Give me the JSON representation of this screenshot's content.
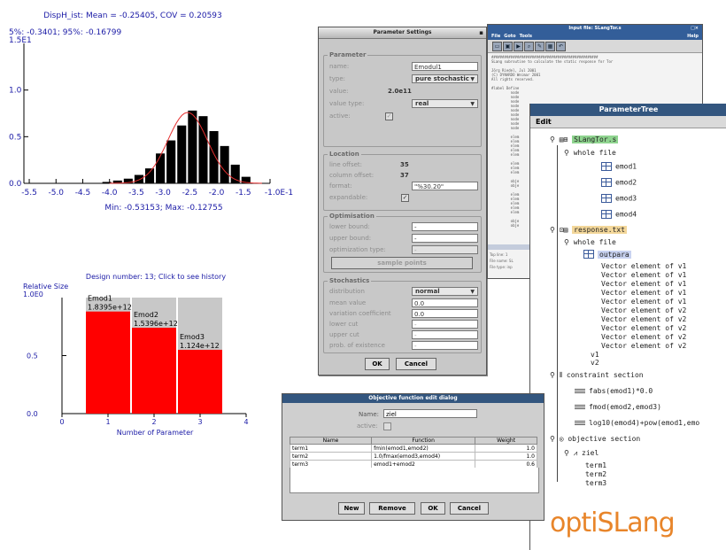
{
  "histogram": {
    "title": "DispH_ist: Mean = -0.25405, COV = 0.20593",
    "percentiles": "5%: -0.3401; 95%: -0.16799",
    "y_multiplier": "1.5E1",
    "y_ticks": [
      "1.0",
      "0.5",
      "0.0"
    ],
    "x_ticks": [
      "-5.5",
      "-5.0",
      "-4.5",
      "-4.0",
      "-3.5",
      "-3.0",
      "-2.5",
      "-2.0",
      "-1.5",
      "-1.0E-1"
    ],
    "range_text": "Min: -0.53153; Max: -0.12755"
  },
  "bar_chart": {
    "title": "Design number: 13; Click to see history",
    "ylabel": "Relative Size",
    "y_top": "1.0E0",
    "y_ticks": [
      "0.5",
      "0.0"
    ],
    "x_ticks": [
      "0",
      "1",
      "2",
      "3",
      "4"
    ],
    "xlabel": "Number of Parameter",
    "bars": [
      {
        "label": "Emod1",
        "value_text": "1.8395e+12"
      },
      {
        "label": "Emod2",
        "value_text": "1.5396e+12"
      },
      {
        "label": "Emod3",
        "value_text": "1.124e+12"
      }
    ]
  },
  "chart_data": [
    {
      "type": "bar",
      "title": "DispH_ist: Mean = -0.25405, COV = 0.20593",
      "x": [
        -4.05,
        -3.85,
        -3.65,
        -3.45,
        -3.25,
        -3.05,
        -2.85,
        -2.65,
        -2.45,
        -2.25,
        -2.05,
        -1.85,
        -1.65,
        -1.45
      ],
      "values": [
        0.015,
        0.03,
        0.05,
        0.09,
        0.16,
        0.32,
        0.46,
        0.62,
        0.78,
        0.72,
        0.56,
        0.4,
        0.2,
        0.07
      ],
      "xlim": [
        -5.6,
        -1.0
      ],
      "ylim": [
        0,
        1.5
      ],
      "fit_curve": true,
      "fit_color": "#e53030"
    },
    {
      "type": "bar",
      "title": "Design number: 13; Click to see history",
      "categories": [
        "Emod1",
        "Emod2",
        "Emod3"
      ],
      "x": [
        1,
        2,
        3
      ],
      "values": [
        0.88,
        0.74,
        0.55
      ],
      "xlim": [
        0,
        4
      ],
      "ylim": [
        0,
        1.0
      ],
      "xlabel": "Number of Parameter",
      "ylabel": "Relative Size",
      "bar_color": "#ff0000",
      "background_color": "#c8c8c8"
    }
  ],
  "param_settings": {
    "title": "Parameter Settings",
    "parameter_group": "Parameter",
    "name_label": "name:",
    "name_value": "Emodul1",
    "type_label": "type:",
    "type_value": "pure stochastic",
    "value_label": "value:",
    "value_value": "2.0e11",
    "value_type_label": "value type:",
    "value_type_value": "real",
    "active_label": "active:",
    "location_group": "Location",
    "line_offset_label": "line offset:",
    "line_offset_value": "35",
    "column_offset_label": "column offset:",
    "column_offset_value": "37",
    "format_label": "format:",
    "format_value": "\"%30.20\"",
    "expandable_label": "expandable:",
    "optimisation_group": "Optimisation",
    "lower_bound_label": "lower bound:",
    "upper_bound_label": "upper bound:",
    "opt_type_label": "optimization type:",
    "sample_points": "sample points",
    "stochastics_group": "Stochastics",
    "distribution_label": "distribution",
    "distribution_value": "normal",
    "mean_label": "mean value",
    "mean_value": "0.0",
    "cov_label": "variation coefficient",
    "cov_value": "0.0",
    "lower_cut_label": "lower cut",
    "upper_cut_label": "upper cut",
    "prob_label": "prob. of existence",
    "ok": "OK",
    "cancel": "Cancel"
  },
  "input_file": {
    "title": "Input file: SLangTor.s",
    "menu": [
      "File",
      "Goto",
      "Tools"
    ],
    "help": "Help",
    "lines": [
      "##################################################",
      "SLang subroutine to calculate the static response for Tor",
      "",
      "Jörg Riedel, Jul 2001",
      "(C) DYNARDO Weimar 2001",
      "All rights reserved.",
      "",
      "#label Define",
      "         node",
      "         node",
      "         node",
      "         node",
      "         node",
      "         node",
      "         node",
      "         node",
      "         node",
      "",
      "         elem",
      "         elem",
      "         elem",
      "         elem",
      "         elem",
      "",
      "         elem",
      "         elem",
      "         elem",
      "",
      "         obje",
      "         obje",
      "",
      "         elem",
      "         elem",
      "         elem",
      "         elem",
      "         elem",
      "",
      "         obje",
      "         obje"
    ],
    "status": [
      "Top line: 1",
      "File name: SL",
      "File type: inp"
    ]
  },
  "param_tree": {
    "title": "ParameterTree",
    "menu": "Edit",
    "file1": "SLangTor.s",
    "whole_file_1": "whole file",
    "emods": [
      "emod1",
      "emod2",
      "emod3",
      "emod4"
    ],
    "file2": "response.txt",
    "whole_file_2": "whole file",
    "outpara": "outpara",
    "vectors": [
      "Vector element of v1",
      "Vector element of v1",
      "Vector element of v1",
      "Vector element of v1",
      "Vector element of v1",
      "Vector element of v2",
      "Vector element of v2",
      "Vector element of v2",
      "Vector element of v2",
      "Vector element of v2"
    ],
    "v1": "v1",
    "v2": "v2",
    "constraint_section": "constraint section",
    "constraints": [
      "fabs(emod1)*0.0",
      "fmod(emod2,emod3)",
      "log10(emod4)+pow(emod1,emo"
    ],
    "objective_section": "objective section",
    "ziel": "ziel",
    "terms": [
      "term1",
      "term2",
      "term3"
    ]
  },
  "objective_dialog": {
    "title": "Objective function edit dialog",
    "name_label": "Name:",
    "name_value": "ziel",
    "active_label": "active:",
    "columns": [
      "Name",
      "Function",
      "Weight"
    ],
    "rows": [
      [
        "term1",
        "fmin(emod1,emod2)",
        "1.0"
      ],
      [
        "term2",
        "1.0/fmax(emod3,emod4)",
        "1.0"
      ],
      [
        "term3",
        "emod1+emod2",
        "0.6"
      ]
    ],
    "new": "New",
    "remove": "Remove",
    "ok": "OK",
    "cancel": "Cancel"
  },
  "logo": "optiSLang",
  "colors": {
    "accent_blue": "#1a1aa6",
    "logo_orange": "#e8852a",
    "bar_red": "#ff0000",
    "title_blue": "#33567f"
  }
}
